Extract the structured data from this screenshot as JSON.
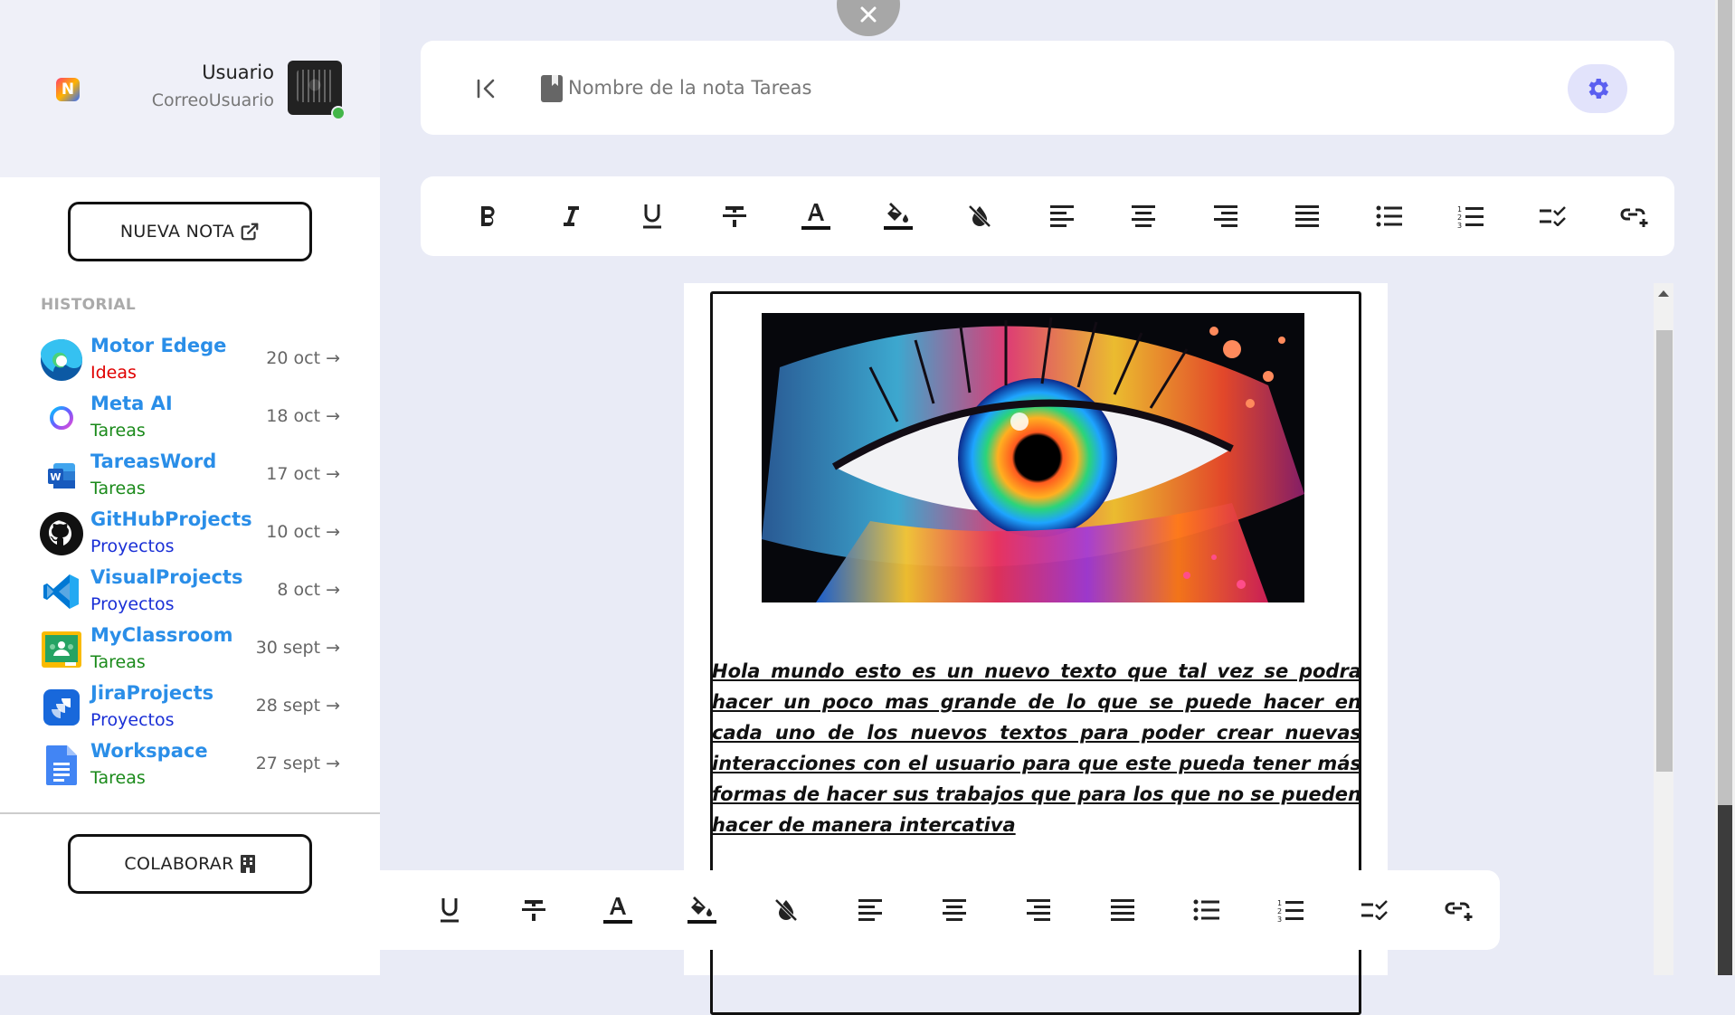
{
  "user": {
    "name": "Usuario",
    "email": "CorreoUsuario"
  },
  "sidebar": {
    "new_note_label": "NUEVA NOTA",
    "history_label": "HISTORIAL",
    "collaborate_label": "COLABORAR",
    "history": [
      {
        "title": "Motor Edege",
        "category": "Ideas",
        "category_color": "#e00000",
        "date": "20 oct →",
        "icon": "edge-icon"
      },
      {
        "title": "Meta AI",
        "category": "Tareas",
        "category_color": "#1a8a1a",
        "date": "18 oct →",
        "icon": "meta-ai-icon"
      },
      {
        "title": "TareasWord",
        "category": "Tareas",
        "category_color": "#1a8a1a",
        "date": "17 oct →",
        "icon": "word-icon"
      },
      {
        "title": "GitHubProjects",
        "category": "Proyectos",
        "category_color": "#1a2fd6",
        "date": "10 oct →",
        "icon": "github-icon"
      },
      {
        "title": "VisualProjects",
        "category": "Proyectos",
        "category_color": "#1a2fd6",
        "date": "8 oct →",
        "icon": "vscode-icon"
      },
      {
        "title": "MyClassroom",
        "category": "Tareas",
        "category_color": "#1a8a1a",
        "date": "30 sept →",
        "icon": "classroom-icon"
      },
      {
        "title": "JiraProjects",
        "category": "Proyectos",
        "category_color": "#1a2fd6",
        "date": "28 sept →",
        "icon": "jira-icon"
      },
      {
        "title": "Workspace",
        "category": "Tareas",
        "category_color": "#1a8a1a",
        "date": "27 sept →",
        "icon": "docs-icon"
      }
    ]
  },
  "header": {
    "note_title": "Nombre de la nota Tareas"
  },
  "toolbar_top": [
    "bold",
    "italic",
    "underline",
    "strikethrough",
    "font-color",
    "fill-color",
    "clear-format",
    "align-left",
    "align-center",
    "align-right",
    "align-justify",
    "bullet-list",
    "numbered-list",
    "checklist",
    "add-link"
  ],
  "toolbar_bottom": [
    "underline",
    "strikethrough",
    "font-color",
    "fill-color",
    "clear-format",
    "align-left",
    "align-center",
    "align-right",
    "align-justify",
    "bullet-list",
    "numbered-list",
    "checklist",
    "add-link"
  ],
  "document": {
    "image_subject": "colorful painted eye",
    "text": "Hola mundo esto es un nuevo texto que tal vez se podra hacer un poco mas grande de lo que se puede hacer en cada uno de los nuevos textos para poder crear nuevas interacciones con el usuario para que este pueda tener más formas de hacer sus trabajos que para los que no se pueden hacer de manera intercativa"
  },
  "colors": {
    "accent": "#5b5ff0",
    "link_blue": "#2a8ee8",
    "background": "#e9ebf6"
  }
}
